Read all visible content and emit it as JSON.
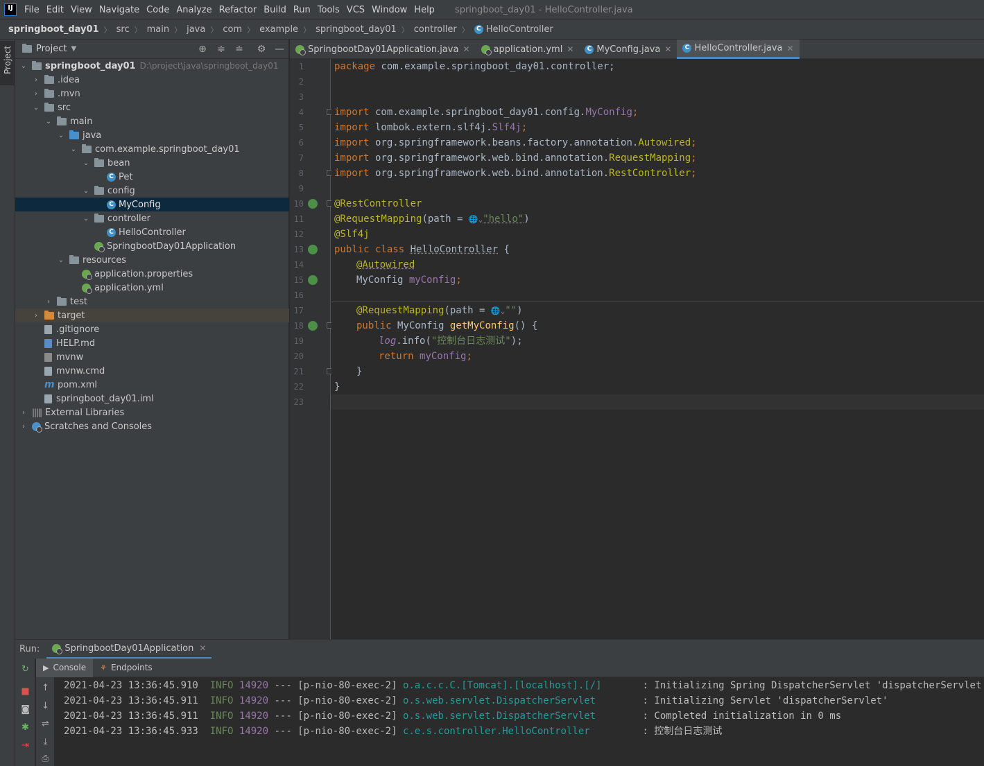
{
  "menubar": {
    "logo": "IJ",
    "items": [
      "File",
      "Edit",
      "View",
      "Navigate",
      "Code",
      "Analyze",
      "Refactor",
      "Build",
      "Run",
      "Tools",
      "VCS",
      "Window",
      "Help"
    ],
    "window_title": "springboot_day01 - HelloController.java"
  },
  "breadcrumb": [
    "springboot_day01",
    "src",
    "main",
    "java",
    "com",
    "example",
    "springboot_day01",
    "controller",
    "HelloController"
  ],
  "left_strip": {
    "project_label": "Project"
  },
  "project_panel": {
    "title": "Project",
    "root_name": "springboot_day01",
    "root_path": "D:\\project\\java\\springboot_day01",
    "tree": [
      ".idea",
      ".mvn",
      "src",
      "main",
      "java",
      "com.example.springboot_day01",
      "bean",
      "Pet",
      "config",
      "MyConfig",
      "controller",
      "HelloController",
      "SpringbootDay01Application",
      "resources",
      "application.properties",
      "application.yml",
      "test",
      "target",
      ".gitignore",
      "HELP.md",
      "mvnw",
      "mvnw.cmd",
      "pom.xml",
      "springboot_day01.iml",
      "External Libraries",
      "Scratches and Consoles"
    ]
  },
  "editor_tabs": [
    "SpringbootDay01Application.java",
    "application.yml",
    "MyConfig.java",
    "HelloController.java"
  ],
  "code": {
    "line_numbers": [
      "1",
      "2",
      "3",
      "4",
      "5",
      "6",
      "7",
      "8",
      "9",
      "10",
      "11",
      "12",
      "13",
      "14",
      "15",
      "16",
      "17",
      "18",
      "19",
      "20",
      "21",
      "22",
      "23"
    ],
    "l1_kw": "package",
    "l1_rest": " com.example.springboot_day01.controller;",
    "l4_kw": "import",
    "l4_pkg": " com.example.springboot_day01.config.",
    "l4_cls": "MyConfig",
    "l4_end": ";",
    "l5_kw": "import",
    "l5_pkg": " lombok.extern.slf4j.",
    "l5_cls": "Slf4j",
    "l5_end": ";",
    "l6_kw": "import",
    "l6_pkg": " org.springframework.beans.factory.annotation.",
    "l6_cls": "Autowired",
    "l6_end": ";",
    "l7_kw": "import",
    "l7_pkg": " org.springframework.web.bind.annotation.",
    "l7_cls": "RequestMapping",
    "l7_end": ";",
    "l8_kw": "import",
    "l8_pkg": " org.springframework.web.bind.annotation.",
    "l8_cls": "RestController",
    "l8_end": ";",
    "l10_ann": "@RestController",
    "l11_ann": "@RequestMapping",
    "l11_a": "(path = ",
    "l11_hint": "🌐⌄",
    "l11_str": "\"hello\"",
    "l11_end": ")",
    "l12_ann": "@Slf4j",
    "l13_kw": "public class",
    "l13_sp": " ",
    "l13_cls": "HelloController",
    "l13_end": " {",
    "l14_ann": "@Autowired",
    "l15_type": "MyConfig",
    "l15_sp": " ",
    "l15_field": "myConfig",
    "l15_end": ";",
    "l17_ann": "@RequestMapping",
    "l17_a": "(path = ",
    "l17_hint": "🌐⌄",
    "l17_str": "\"\"",
    "l17_end": ")",
    "l18_kw": "public",
    "l18_type": " MyConfig ",
    "l18_fn": "getMyConfig",
    "l18_end": "() {",
    "l19_field": "log",
    "l19_a": ".info(",
    "l19_str": "\"控制台日志测试\"",
    "l19_end": ");",
    "l20_kw": "return",
    "l20_sp": " ",
    "l20_field": "myConfig",
    "l20_end": ";",
    "l21": "}",
    "l22": "}"
  },
  "run_panel": {
    "label": "Run:",
    "tab": "SpringbootDay01Application",
    "console_tab": "Console",
    "endpoints_tab": "Endpoints"
  },
  "log": [
    {
      "ts": "2021-04-23 13:36:45.910",
      "level": "INFO",
      "pid": "14920",
      "sep": "---",
      "thread": "[p-nio-80-exec-2]",
      "logger": "o.a.c.c.C.[Tomcat].[localhost].[/]",
      "msg": ": Initializing Spring DispatcherServlet 'dispatcherServlet'"
    },
    {
      "ts": "2021-04-23 13:36:45.911",
      "level": "INFO",
      "pid": "14920",
      "sep": "---",
      "thread": "[p-nio-80-exec-2]",
      "logger": "o.s.web.servlet.DispatcherServlet",
      "msg": ": Initializing Servlet 'dispatcherServlet'"
    },
    {
      "ts": "2021-04-23 13:36:45.911",
      "level": "INFO",
      "pid": "14920",
      "sep": "---",
      "thread": "[p-nio-80-exec-2]",
      "logger": "o.s.web.servlet.DispatcherServlet",
      "msg": ": Completed initialization in 0 ms"
    },
    {
      "ts": "2021-04-23 13:36:45.933",
      "level": "INFO",
      "pid": "14920",
      "sep": "---",
      "thread": "[p-nio-80-exec-2]",
      "logger": "c.e.s.controller.HelloController",
      "msg": ": 控制台日志测试"
    }
  ],
  "colors": {
    "keyword": "#cc7832",
    "annotation": "#bbb529",
    "field": "#9876aa",
    "string": "#6a8759",
    "method": "#ffc66d",
    "accent": "#4a88c7",
    "selection": "#0d293e"
  },
  "icons": [
    "project-folder-icon",
    "locate-icon",
    "expand-all-icon",
    "collapse-all-icon",
    "settings-icon",
    "minimize-icon",
    "rerun-icon",
    "stop-icon",
    "camera-icon",
    "debug-icon",
    "exit-icon"
  ]
}
